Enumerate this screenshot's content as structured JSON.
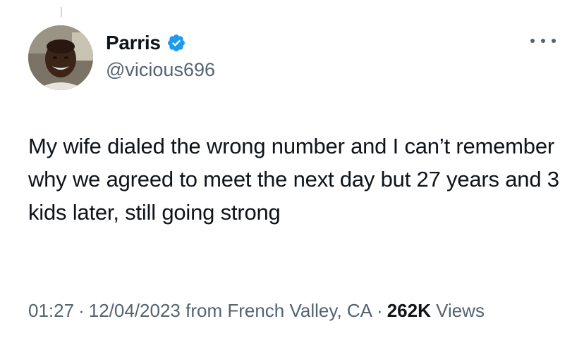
{
  "tweet": {
    "author": {
      "display_name": "Parris",
      "handle": "@vicious696",
      "verified": true,
      "verified_color": "#1d9bf0"
    },
    "text": "My wife dialed the wrong number and I can’t remember why we agreed to meet the next day but 27 years and 3 kids later, still going strong",
    "meta": {
      "time": "01:27",
      "separator": "·",
      "date": "12/04/2023",
      "location": "from French Valley, CA",
      "views_count": "262K",
      "views_label": "Views"
    },
    "icons": {
      "more": "more-horizontal-icon",
      "verified": "verified-badge-icon"
    }
  }
}
